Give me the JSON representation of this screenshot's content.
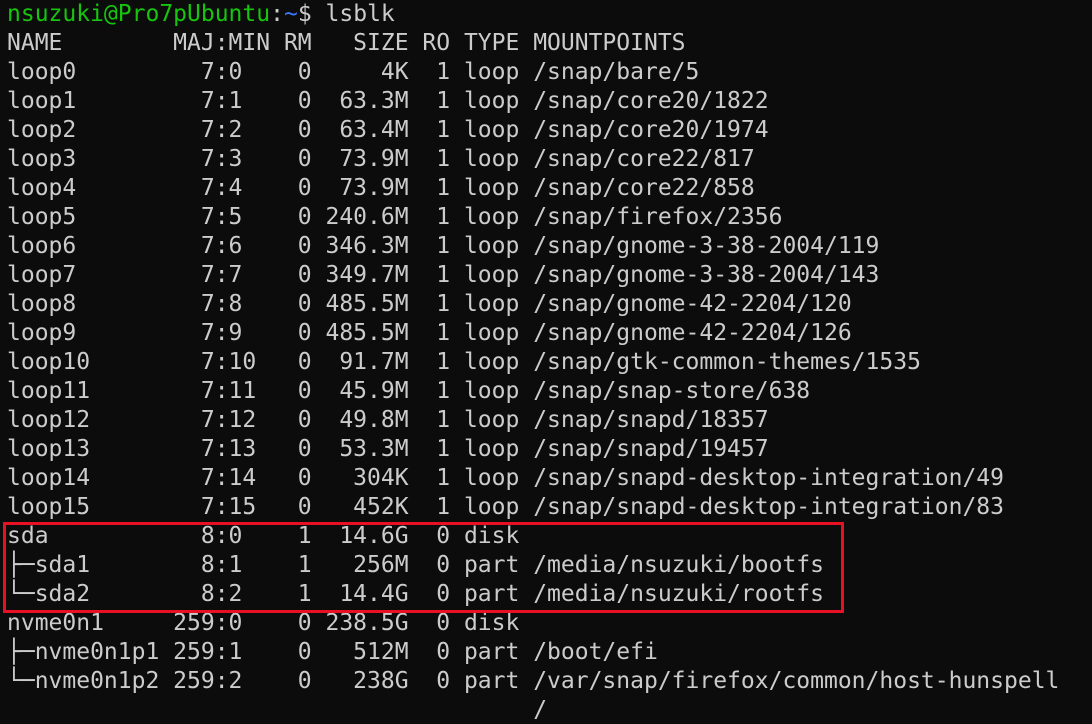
{
  "prompt": {
    "user_host": "nsuzuki@Pro7pUbuntu",
    "separator": ":",
    "path": "~",
    "symbol": "$ ",
    "command": "lsblk"
  },
  "lines": [
    "NAME        MAJ:MIN RM   SIZE RO TYPE MOUNTPOINTS",
    "loop0         7:0    0     4K  1 loop /snap/bare/5",
    "loop1         7:1    0  63.3M  1 loop /snap/core20/1822",
    "loop2         7:2    0  63.4M  1 loop /snap/core20/1974",
    "loop3         7:3    0  73.9M  1 loop /snap/core22/817",
    "loop4         7:4    0  73.9M  1 loop /snap/core22/858",
    "loop5         7:5    0 240.6M  1 loop /snap/firefox/2356",
    "loop6         7:6    0 346.3M  1 loop /snap/gnome-3-38-2004/119",
    "loop7         7:7    0 349.7M  1 loop /snap/gnome-3-38-2004/143",
    "loop8         7:8    0 485.5M  1 loop /snap/gnome-42-2204/120",
    "loop9         7:9    0 485.5M  1 loop /snap/gnome-42-2204/126",
    "loop10        7:10   0  91.7M  1 loop /snap/gtk-common-themes/1535",
    "loop11        7:11   0  45.9M  1 loop /snap/snap-store/638",
    "loop12        7:12   0  49.8M  1 loop /snap/snapd/18357",
    "loop13        7:13   0  53.3M  1 loop /snap/snapd/19457",
    "loop14        7:14   0   304K  1 loop /snap/snapd-desktop-integration/49",
    "loop15        7:15   0   452K  1 loop /snap/snapd-desktop-integration/83",
    "sda           8:0    1  14.6G  0 disk ",
    "├─sda1        8:1    1   256M  0 part /media/nsuzuki/bootfs",
    "└─sda2        8:2    1  14.4G  0 part /media/nsuzuki/rootfs",
    "nvme0n1     259:0    0 238.5G  0 disk ",
    "├─nvme0n1p1 259:1    0   512M  0 part /boot/efi",
    "└─nvme0n1p2 259:2    0   238G  0 part /var/snap/firefox/common/host-hunspell",
    "                                      /"
  ],
  "colors": {
    "background": "#0c0c0c",
    "foreground": "#cccccc",
    "prompt_user": "#16c60c",
    "prompt_path": "#3b78ff",
    "highlight": "#e81123"
  }
}
